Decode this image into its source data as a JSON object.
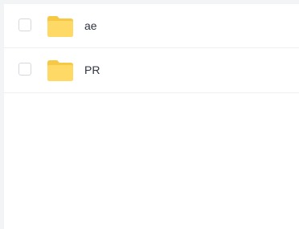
{
  "file_list": {
    "items": [
      {
        "name": "ae",
        "type_icon": "folder-icon",
        "checked": false
      },
      {
        "name": "PR",
        "type_icon": "folder-icon",
        "checked": false
      }
    ]
  },
  "colors": {
    "folder_back": "#f7c843",
    "folder_front": "#ffd966",
    "text": "#2f3440",
    "divider": "#eef0f3",
    "gutter": "#f3f4f6"
  }
}
